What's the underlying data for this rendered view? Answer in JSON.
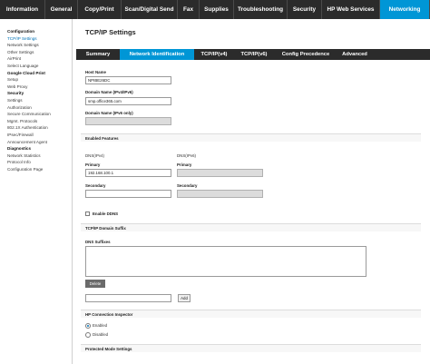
{
  "topnav": {
    "items": [
      {
        "label": "Information"
      },
      {
        "label": "General"
      },
      {
        "label": "Copy/Print"
      },
      {
        "label": "Scan/Digital Send"
      },
      {
        "label": "Fax"
      },
      {
        "label": "Supplies"
      },
      {
        "label": "Troubleshooting"
      },
      {
        "label": "Security"
      },
      {
        "label": "HP Web Services"
      },
      {
        "label": "Networking"
      }
    ],
    "active_index": 9,
    "colors": {
      "bar": "#2b2b2b",
      "active": "#0096d6"
    }
  },
  "sidebar": {
    "items": [
      {
        "label": "Configuration",
        "type": "head"
      },
      {
        "label": "TCP/IP Settings",
        "type": "active"
      },
      {
        "label": "Network Settings",
        "type": "item"
      },
      {
        "label": "Other Settings",
        "type": "item"
      },
      {
        "label": "AirPrint",
        "type": "item"
      },
      {
        "label": "Select Language",
        "type": "item"
      },
      {
        "label": "Google Cloud Print",
        "type": "head"
      },
      {
        "label": "Setup",
        "type": "item"
      },
      {
        "label": "Web Proxy",
        "type": "item"
      },
      {
        "label": "Security",
        "type": "head"
      },
      {
        "label": "Settings",
        "type": "item"
      },
      {
        "label": "Authorization",
        "type": "item"
      },
      {
        "label": "Secure Communication",
        "type": "item"
      },
      {
        "label": "Mgmt. Protocols",
        "type": "item"
      },
      {
        "label": "802.1X Authentication",
        "type": "item"
      },
      {
        "label": "IPsec/Firewall",
        "type": "item"
      },
      {
        "label": "Announcement Agent",
        "type": "item"
      },
      {
        "label": "Diagnostics",
        "type": "head"
      },
      {
        "label": "Network Statistics",
        "type": "item"
      },
      {
        "label": "Protocol Info",
        "type": "item"
      },
      {
        "label": "Configuration Page",
        "type": "item"
      }
    ]
  },
  "main": {
    "title": "TCP/IP Settings",
    "tabs": [
      {
        "label": "Summary"
      },
      {
        "label": "Network Identification"
      },
      {
        "label": "TCP/IP(v4)"
      },
      {
        "label": "TCP/IP(v6)"
      },
      {
        "label": "Config Precedence"
      },
      {
        "label": "Advanced"
      }
    ],
    "active_tab": 1,
    "host_name": {
      "label": "Host Name",
      "value": "NPIBE26DC"
    },
    "domain_ipv4_ipv6": {
      "label": "Domain Name (IPv4/IPv6)",
      "value": "smp.office365.com"
    },
    "domain_ipv6_only": {
      "label": "Domain Name (IPv6 only)",
      "value": ""
    },
    "enabled_features": {
      "label": "Enabled Features"
    },
    "dns_ipv4": {
      "heading": "DNS(IPv4)",
      "primary_label": "Primary",
      "primary_value": "192.168.100.1",
      "secondary_label": "Secondary",
      "secondary_value": ""
    },
    "dns_ipv6": {
      "heading": "DNS(IPv6)",
      "primary_label": "Primary",
      "primary_value": "",
      "secondary_label": "Secondary",
      "secondary_value": ""
    },
    "enable_ddns": {
      "label": "Enable DDNS",
      "checked": false
    },
    "domain_suffix": {
      "section_label": "TCP/IP Domain Suffix",
      "list_label": "DNS Suffixes",
      "delete_label": "Delete",
      "add_label": "Add",
      "new_value": ""
    },
    "connection_inspector": {
      "section_label": "HP Connection Inspector",
      "enabled_label": "Enabled",
      "disabled_label": "Disabled",
      "selected": "enabled"
    },
    "protected_mode": {
      "section_label": "Protected Mode Settings"
    }
  }
}
